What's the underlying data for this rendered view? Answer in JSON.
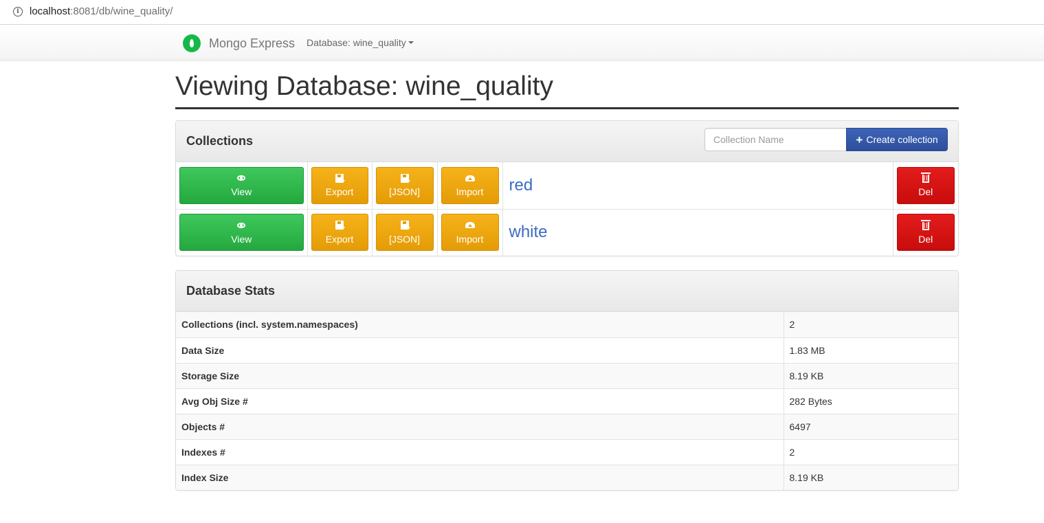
{
  "browser": {
    "url_host": "localhost",
    "url_path": ":8081/db/wine_quality/"
  },
  "navbar": {
    "brand": "Mongo Express",
    "database_label": "Database: wine_quality"
  },
  "page": {
    "title": "Viewing Database: wine_quality"
  },
  "collections_panel": {
    "title": "Collections",
    "input_placeholder": "Collection Name",
    "create_button": "Create collection",
    "rows": [
      {
        "view": "View",
        "export": "Export",
        "json": "[JSON]",
        "import": "Import",
        "name": "red",
        "del": "Del"
      },
      {
        "view": "View",
        "export": "Export",
        "json": "[JSON]",
        "import": "Import",
        "name": "white",
        "del": "Del"
      }
    ]
  },
  "stats_panel": {
    "title": "Database Stats",
    "rows": [
      {
        "label": "Collections (incl. system.namespaces)",
        "value": "2"
      },
      {
        "label": "Data Size",
        "value": "1.83 MB"
      },
      {
        "label": "Storage Size",
        "value": "8.19 KB"
      },
      {
        "label": "Avg Obj Size #",
        "value": "282 Bytes"
      },
      {
        "label": "Objects #",
        "value": "6497"
      },
      {
        "label": "Indexes #",
        "value": "2"
      },
      {
        "label": "Index Size",
        "value": "8.19 KB"
      }
    ]
  },
  "colors": {
    "view_button": "#2fb84c",
    "warning_button": "#eda70f",
    "danger_button": "#d61212",
    "primary_button": "#3358a8",
    "brand_green": "#17b84a"
  }
}
